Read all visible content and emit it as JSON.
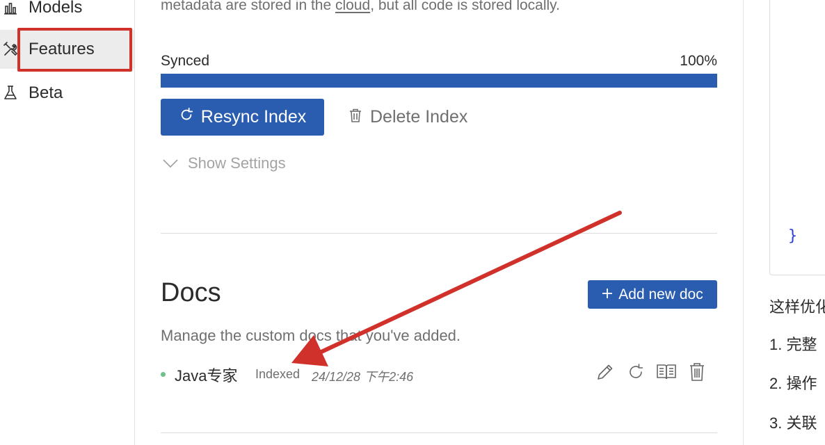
{
  "sidebar": {
    "items": [
      {
        "label": "Models",
        "icon": "bar-chart-icon"
      },
      {
        "label": "Features",
        "icon": "tools-icon"
      },
      {
        "label": "Beta",
        "icon": "flask-icon"
      }
    ]
  },
  "index": {
    "intro_prefix": "metadata are stored in the ",
    "intro_link": "cloud",
    "intro_suffix": ", but all code is stored locally.",
    "status_label": "Synced",
    "progress_text": "100%",
    "progress_fraction": 1.0,
    "resync_label": "Resync Index",
    "delete_label": "Delete Index",
    "show_settings_label": "Show Settings"
  },
  "docs": {
    "title": "Docs",
    "add_label": "Add new doc",
    "description": "Manage the custom docs that you've added.",
    "items": [
      {
        "name": "Java专家",
        "status": "Indexed",
        "timestamp": "24/12/28 下午2:46"
      }
    ]
  },
  "right_panel": {
    "code_brace": "}",
    "lines": [
      "这样优化",
      "1. 完整",
      "2. 操作",
      "3. 关联"
    ]
  },
  "colors": {
    "accent": "#2a5db0",
    "highlight_box": "#d0322b",
    "annotation_arrow": "#d0322b",
    "status_dot": "#6fc08a"
  }
}
